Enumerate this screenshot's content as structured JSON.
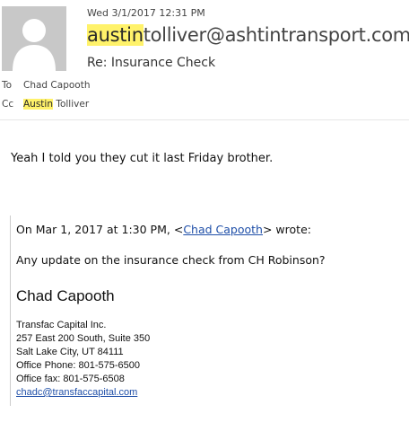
{
  "header": {
    "date": "Wed 3/1/2017 12:31 PM",
    "from_highlight": "austin",
    "from_rest": "tolliver@ashtintransport.com",
    "subject": "Re: Insurance Check",
    "avatar_icon": "person-silhouette-icon"
  },
  "recipients": {
    "to_label": "To",
    "to_value": "Chad Capooth",
    "cc_label": "Cc",
    "cc_highlight": "Austin",
    "cc_rest": " Tolliver"
  },
  "body": {
    "message": "Yeah I told you they cut it last Friday brother."
  },
  "quoted": {
    "header_prefix": "On Mar 1, 2017 at 1:30 PM, <",
    "header_link": "Chad Capooth",
    "header_suffix": "> wrote:",
    "message": "Any update on the insurance check from CH Robinson?"
  },
  "signature": {
    "name": "Chad Capooth",
    "company": "Transfac Capital Inc.",
    "address1": "257 East 200 South, Suite 350",
    "address2": "Salt Lake City, UT 84111",
    "office_phone": "Office Phone: 801-575-6500",
    "office_fax": "Office fax: 801-575-6508",
    "email": "chadc@transfaccapital.com"
  },
  "colors": {
    "highlight": "#fff26a",
    "link": "#1f4fa8",
    "avatar_bg": "#c8c8c8"
  }
}
